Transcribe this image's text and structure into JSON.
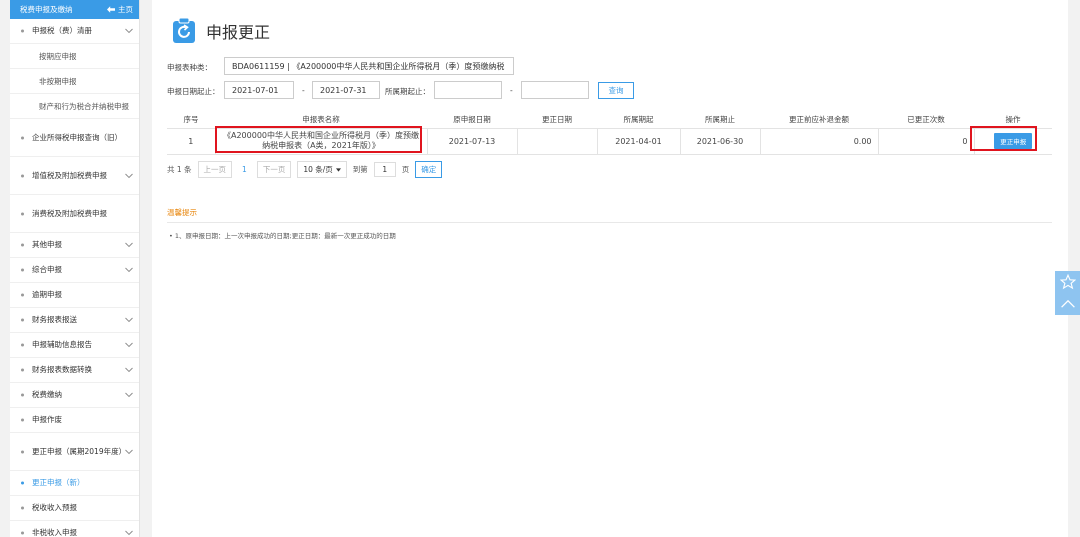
{
  "sidebar": {
    "header_title": "税费申报及缴纳",
    "home_label": "主页",
    "items": [
      {
        "label": "申报税（费）清册",
        "has_chevron": true
      },
      {
        "label": "按期应申报",
        "sub": true
      },
      {
        "label": "非按期申报",
        "sub": true
      },
      {
        "label": "财产和行为税合并纳税申报",
        "sub": true
      },
      {
        "label": "企业所得税申报查询（旧）",
        "has_chevron": false
      },
      {
        "label": "增值税及附加税费申报",
        "has_chevron": true
      },
      {
        "label": "消费税及附加税费申报",
        "has_chevron": false
      },
      {
        "label": "其他申报",
        "has_chevron": true
      },
      {
        "label": "综合申报",
        "has_chevron": true
      },
      {
        "label": "逾期申报",
        "has_chevron": false
      },
      {
        "label": "财务报表报送",
        "has_chevron": true
      },
      {
        "label": "申报辅助信息报告",
        "has_chevron": true
      },
      {
        "label": "财务报表数据转换",
        "has_chevron": true
      },
      {
        "label": "税费缴纳",
        "has_chevron": true
      },
      {
        "label": "申报作废",
        "has_chevron": false
      },
      {
        "label": "更正申报（属期2019年度）",
        "has_chevron": true
      },
      {
        "label": "更正申报（新）",
        "has_chevron": false,
        "active": true
      },
      {
        "label": "税收收入预报",
        "has_chevron": false
      },
      {
        "label": "非税收入申报",
        "has_chevron": true
      }
    ]
  },
  "main": {
    "title": "申报更正",
    "form": {
      "type_label": "申报表种类：",
      "type_value": "BDA0611159 | 《A200000中华人民共和国企业所得税月（季）度预缴纳税",
      "date_label": "申报日期起止：",
      "date_start": "2021-07-01",
      "date_sep": "-",
      "date_end": "2021-07-31",
      "period_label": "所属期起止：",
      "period_start": "",
      "period_sep": "-",
      "period_end": "",
      "query_label": "查询"
    },
    "table": {
      "headers": [
        "序号",
        "申报表名称",
        "原申报日期",
        "更正日期",
        "所属期起",
        "所属期止",
        "更正前应补退金额",
        "已更正次数",
        "操作"
      ],
      "rows": [
        {
          "index": "1",
          "name": "《A200000中华人民共和国企业所得税月（季）度预缴纳税申报表（A类，2021年版）》",
          "orig_date": "2021-07-13",
          "correct_date": "",
          "period_start": "2021-04-01",
          "period_end": "2021-06-30",
          "amount": "0.00",
          "count": "0",
          "action": "更正申报"
        }
      ]
    },
    "pager": {
      "total": "共 1 条",
      "prev": "上一页",
      "current": "1",
      "next": "下一页",
      "size": "10 条/页",
      "goto": "到第",
      "page_input": "1",
      "page_unit": "页",
      "confirm": "确定"
    },
    "tips": {
      "title": "温馨提示",
      "text": "• 1、原申报日期：上一次申报成功的日期;更正日期：最新一次更正成功的日期"
    }
  }
}
